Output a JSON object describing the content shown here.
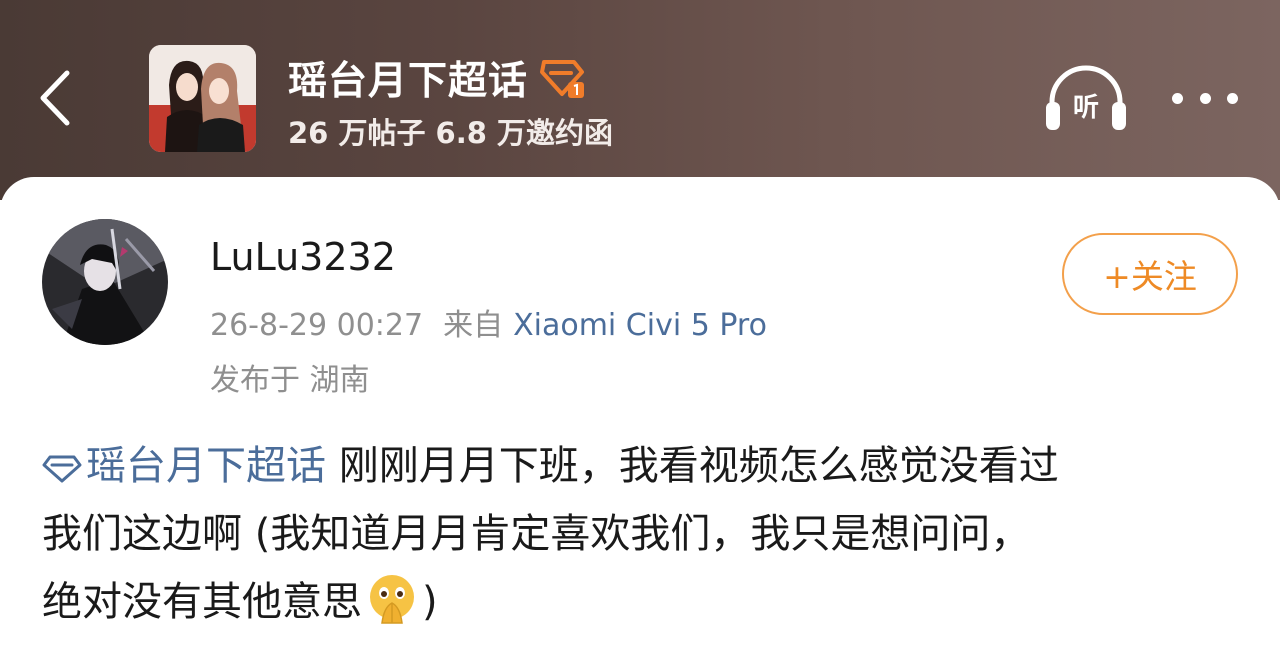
{
  "header": {
    "topic_title": "瑶台月下超话",
    "stats": "26 万帖子 6.8 万邀约函",
    "listen_label": "听"
  },
  "post": {
    "username": "LuLu3232",
    "timestamp": "26-8-29 00:27",
    "from_label": "来自",
    "device": "Xiaomi Civi 5 Pro",
    "location": "发布于 湖南",
    "follow_label": "+关注",
    "topic_link": "瑶台月下超话",
    "line1": "刚刚月月下班，我看视频怎么感觉没看过",
    "line2": "我们这边啊 (我知道月月肯定喜欢我们，我只是想问问，",
    "line3": "绝对没有其他意思",
    "line3_end": ")"
  },
  "colors": {
    "link": "#4b6d9a",
    "follow": "#ee8a25",
    "badge": "#f07c2a"
  },
  "icons": [
    "back-arrow-icon",
    "super-topic-badge-icon",
    "listen-headphones-icon",
    "more-dots-icon",
    "diamond-topic-icon",
    "praying-face-emoji"
  ]
}
